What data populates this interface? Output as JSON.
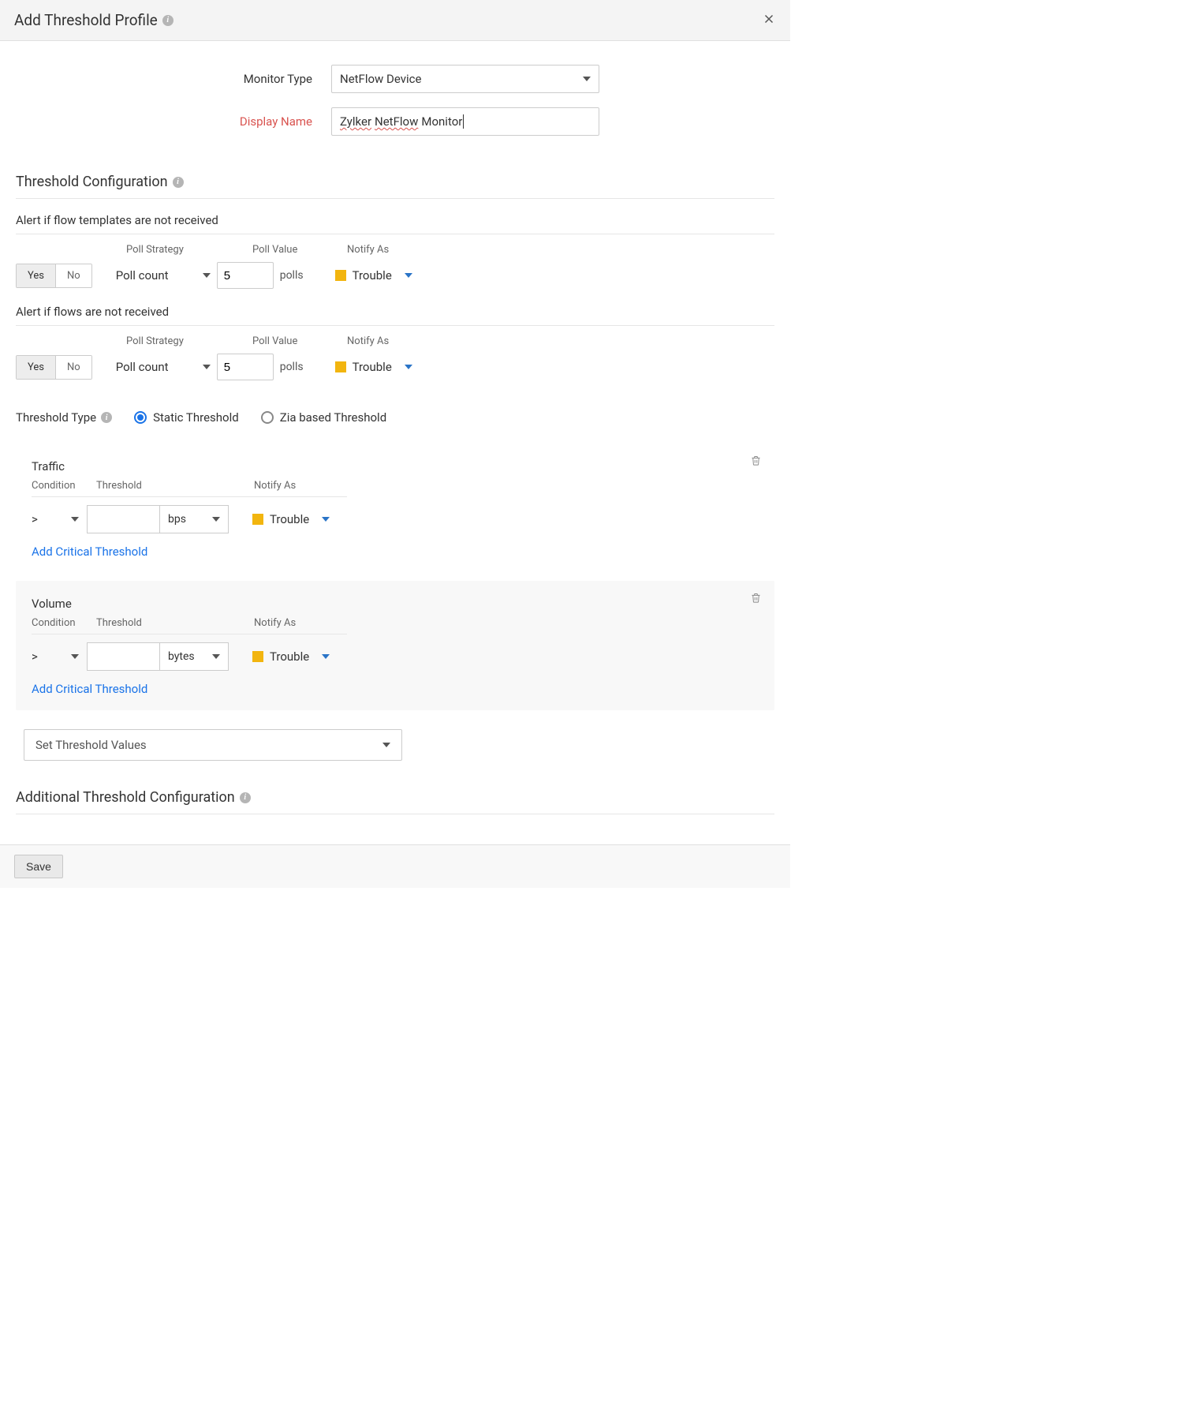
{
  "header": {
    "title": "Add Threshold Profile"
  },
  "form": {
    "monitorTypeLabel": "Monitor Type",
    "monitorTypeValue": "NetFlow Device",
    "displayNameLabel": "Display Name",
    "displayNameValue_word1": "Zylker",
    "displayNameValue_word2": "NetFlow",
    "displayNameValue_word3": "Monitor"
  },
  "sections": {
    "thresholdConfig": "Threshold Configuration",
    "additionalConfig": "Additional Threshold Configuration"
  },
  "flowAlerts": {
    "templateHeading": "Alert if flow templates are not received",
    "flowsHeading": "Alert if flows are not received",
    "cols": {
      "pollStrategy": "Poll Strategy",
      "pollValue": "Poll Value",
      "notifyAs": "Notify As"
    },
    "yes": "Yes",
    "no": "No",
    "pollStrategyValue": "Poll count",
    "pollValueA": "5",
    "pollValueB": "5",
    "pollUnit": "polls",
    "notifyAs": "Trouble"
  },
  "thresholdType": {
    "label": "Threshold Type",
    "static": "Static Threshold",
    "zia": "Zia based Threshold",
    "selected": "static"
  },
  "metrics": {
    "cols": {
      "condition": "Condition",
      "threshold": "Threshold",
      "notifyAs": "Notify As"
    },
    "condValue": ">",
    "addCritical": "Add Critical Threshold",
    "traffic": {
      "title": "Traffic",
      "unit": "bps",
      "value": "",
      "notify": "Trouble"
    },
    "volume": {
      "title": "Volume",
      "unit": "bytes",
      "value": "",
      "notify": "Trouble"
    }
  },
  "setThreshold": "Set Threshold Values",
  "footer": {
    "save": "Save"
  }
}
